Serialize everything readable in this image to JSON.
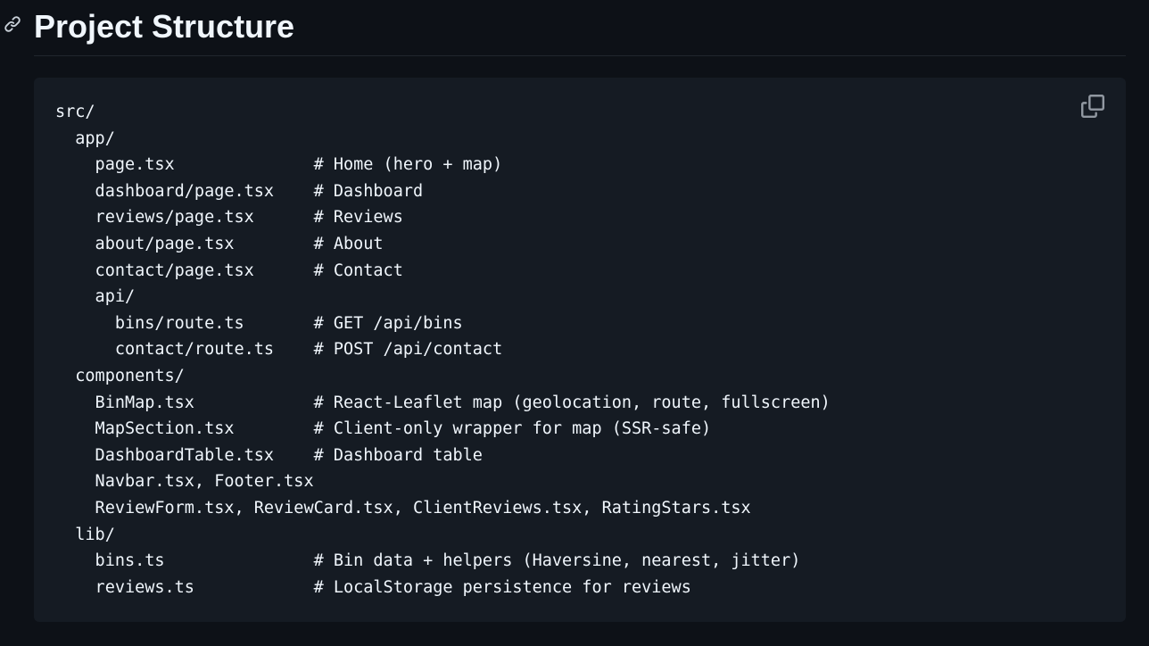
{
  "heading": {
    "title": "Project Structure",
    "anchor_icon": "link-icon"
  },
  "code_block": {
    "copy_icon": "copy-icon",
    "lines": [
      "src/",
      "  app/",
      "    page.tsx              # Home (hero + map)",
      "    dashboard/page.tsx    # Dashboard",
      "    reviews/page.tsx      # Reviews",
      "    about/page.tsx        # About",
      "    contact/page.tsx      # Contact",
      "    api/",
      "      bins/route.ts       # GET /api/bins",
      "      contact/route.ts    # POST /api/contact",
      "  components/",
      "    BinMap.tsx            # React-Leaflet map (geolocation, route, fullscreen)",
      "    MapSection.tsx        # Client-only wrapper for map (SSR-safe)",
      "    DashboardTable.tsx    # Dashboard table",
      "    Navbar.tsx, Footer.tsx",
      "    ReviewForm.tsx, ReviewCard.tsx, ClientReviews.tsx, RatingStars.tsx",
      "  lib/",
      "    bins.ts               # Bin data + helpers (Haversine, nearest, jitter)",
      "    reviews.ts            # LocalStorage persistence for reviews"
    ]
  },
  "colors": {
    "page_background": "#0d1117",
    "code_background": "#151b23",
    "text": "#f0f6fc",
    "icon": "#9198a1",
    "rule": "#21262d"
  }
}
